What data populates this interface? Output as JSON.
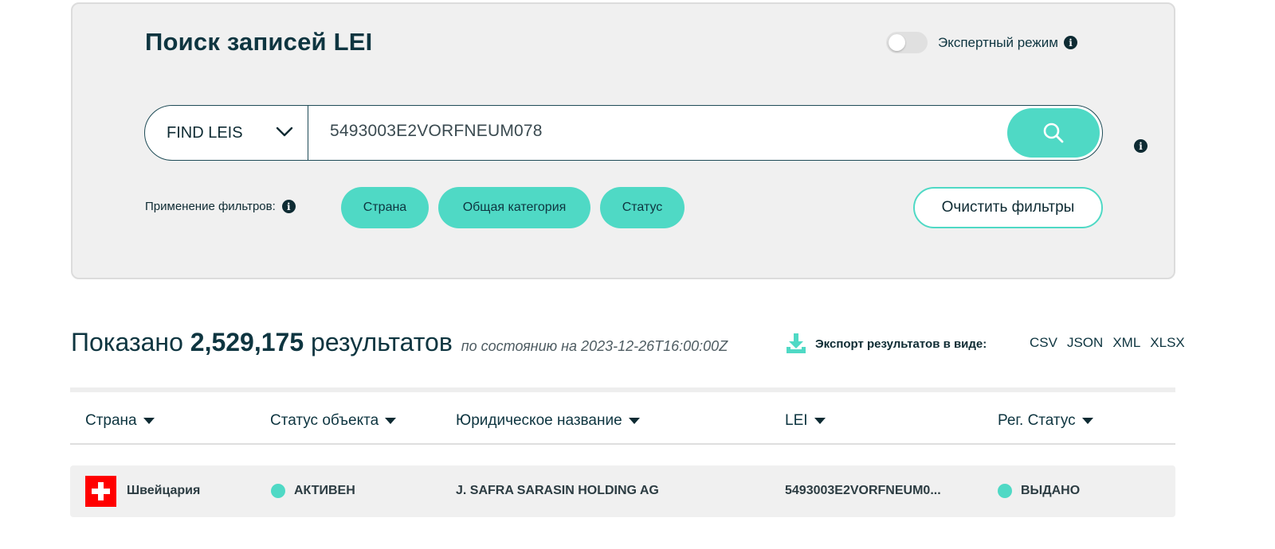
{
  "search_panel": {
    "title": "Поиск записей LEI",
    "expert_mode": {
      "label": "Экспертный режим",
      "enabled": false
    },
    "search_type": "FIND LEIS",
    "search_value": "5493003E2VORFNEUM078",
    "filters_label": "Применение фильтров:",
    "filter_chips": [
      "Страна",
      "Общая категория",
      "Статус"
    ],
    "clear_filters_label": "Очистить фильтры"
  },
  "results": {
    "prefix": "Показано",
    "count": "2,529,175",
    "suffix": "результатов",
    "as_of": "по состоянию на 2023-12-26T16:00:00Z",
    "export_label": "Экспорт результатов в виде:",
    "export_formats": [
      "CSV",
      "JSON",
      "XML",
      "XLSX"
    ]
  },
  "table": {
    "columns": [
      "Страна",
      "Статус объекта",
      "Юридическое название",
      "LEI",
      "Рег. Статус"
    ],
    "rows": [
      {
        "country": "Швейцария",
        "entity_status": "АКТИВЕН",
        "legal_name": "J. SAFRA SARASIN HOLDING AG",
        "lei": "5493003E2VORFNEUM0...",
        "reg_status": "ВЫДАНО"
      }
    ]
  },
  "colors": {
    "accent": "#4fd9c5",
    "text_dark": "#0e3540",
    "panel_bg": "#f0f0f0",
    "flag_red": "#ff0000"
  },
  "icons": {
    "info": "info-icon",
    "search": "search-icon",
    "chevron": "chevron-down-icon",
    "download": "download-icon",
    "sort": "sort-caret-icon",
    "flag": "switzerland-flag-icon"
  }
}
